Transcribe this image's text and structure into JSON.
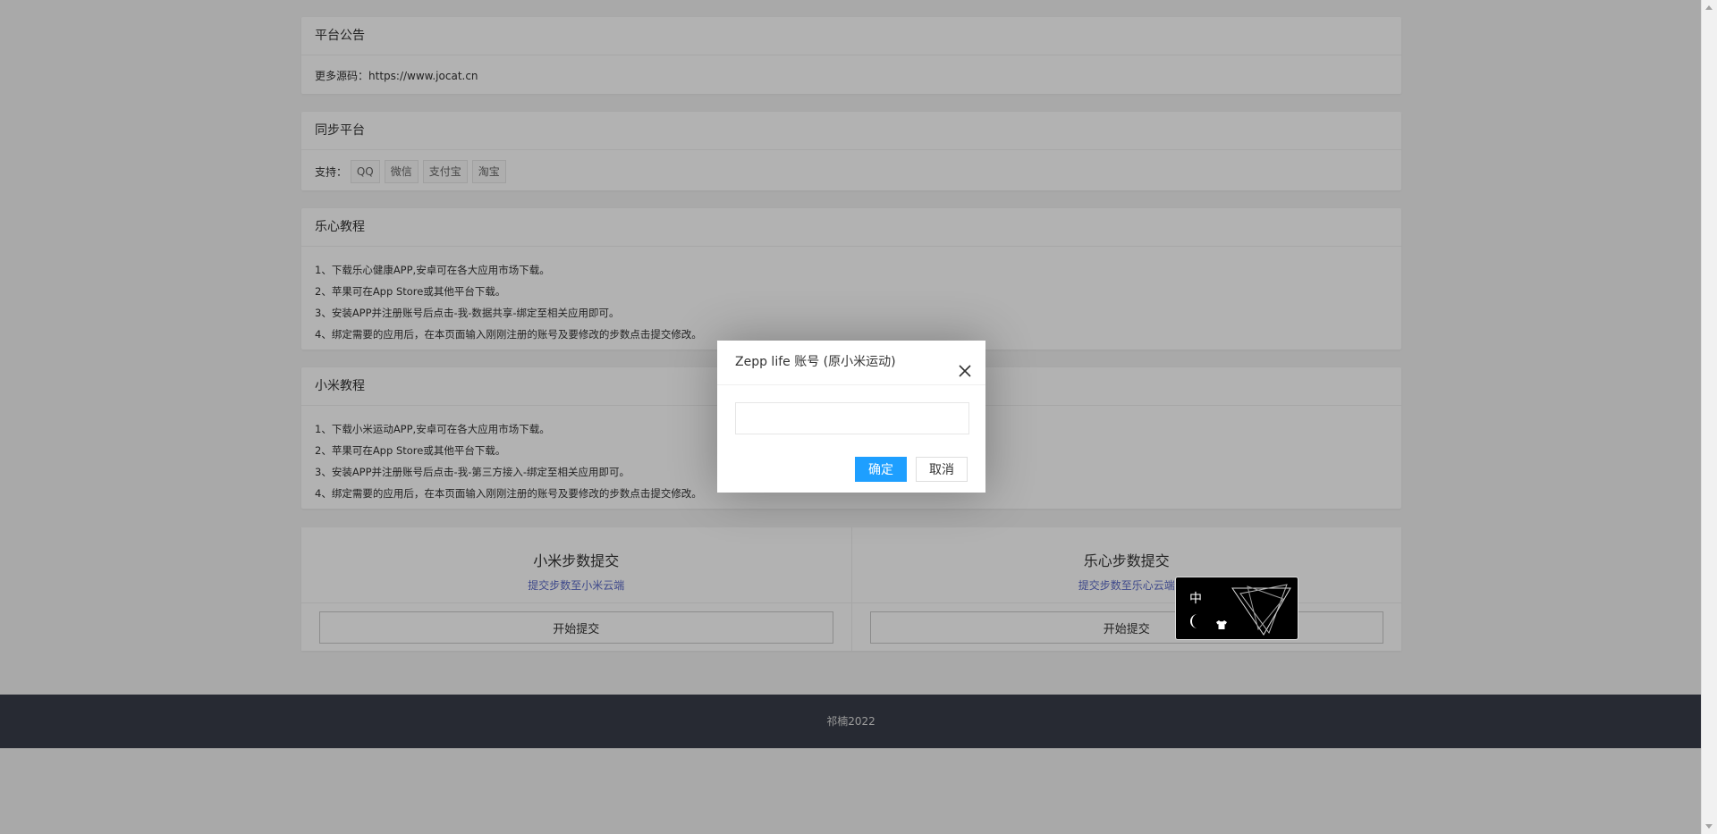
{
  "notice": {
    "title": "平台公告",
    "more_label": "更多源码：",
    "link": "https://www.jocat.cn"
  },
  "sync": {
    "title": "同步平台",
    "support_label": "支持：",
    "platforms": [
      "QQ",
      "微信",
      "支付宝",
      "淘宝"
    ]
  },
  "lexin_tutorial": {
    "title": "乐心教程",
    "steps": [
      "1、下载乐心健康APP,安卓可在各大应用市场下载。",
      "2、苹果可在App Store或其他平台下载。",
      "3、安装APP并注册账号后点击-我-数据共享-绑定至相关应用即可。",
      "4、绑定需要的应用后，在本页面输入刚刚注册的账号及要修改的步数点击提交修改。"
    ]
  },
  "xiaomi_tutorial": {
    "title": "小米教程",
    "steps": [
      "1、下载小米运动APP,安卓可在各大应用市场下载。",
      "2、苹果可在App Store或其他平台下载。",
      "3、安装APP并注册账号后点击-我-第三方接入-绑定至相关应用即可。",
      "4、绑定需要的应用后，在本页面输入刚刚注册的账号及要修改的步数点击提交修改。"
    ]
  },
  "submit": {
    "xiaomi": {
      "title": "小米步数提交",
      "subtitle": "提交步数至小米云端",
      "button": "开始提交"
    },
    "lexin": {
      "title": "乐心步数提交",
      "subtitle": "提交步数至乐心云端",
      "button": "开始提交"
    }
  },
  "footer": {
    "text": "祁楠2022"
  },
  "dialog": {
    "title": "Zepp life 账号 (原小米运动)",
    "input_value": "",
    "input_placeholder": "",
    "ok": "确定",
    "cancel": "取消"
  },
  "widget": {
    "lang": "中"
  },
  "colors": {
    "primary": "#1e9fff",
    "footer_bg": "#393d49",
    "accent_link": "#5b6ac8",
    "overlay": "rgba(0,0,0,0.3)"
  },
  "icons": [
    "close-icon",
    "moon-icon",
    "shirt-icon",
    "triangle-art"
  ]
}
